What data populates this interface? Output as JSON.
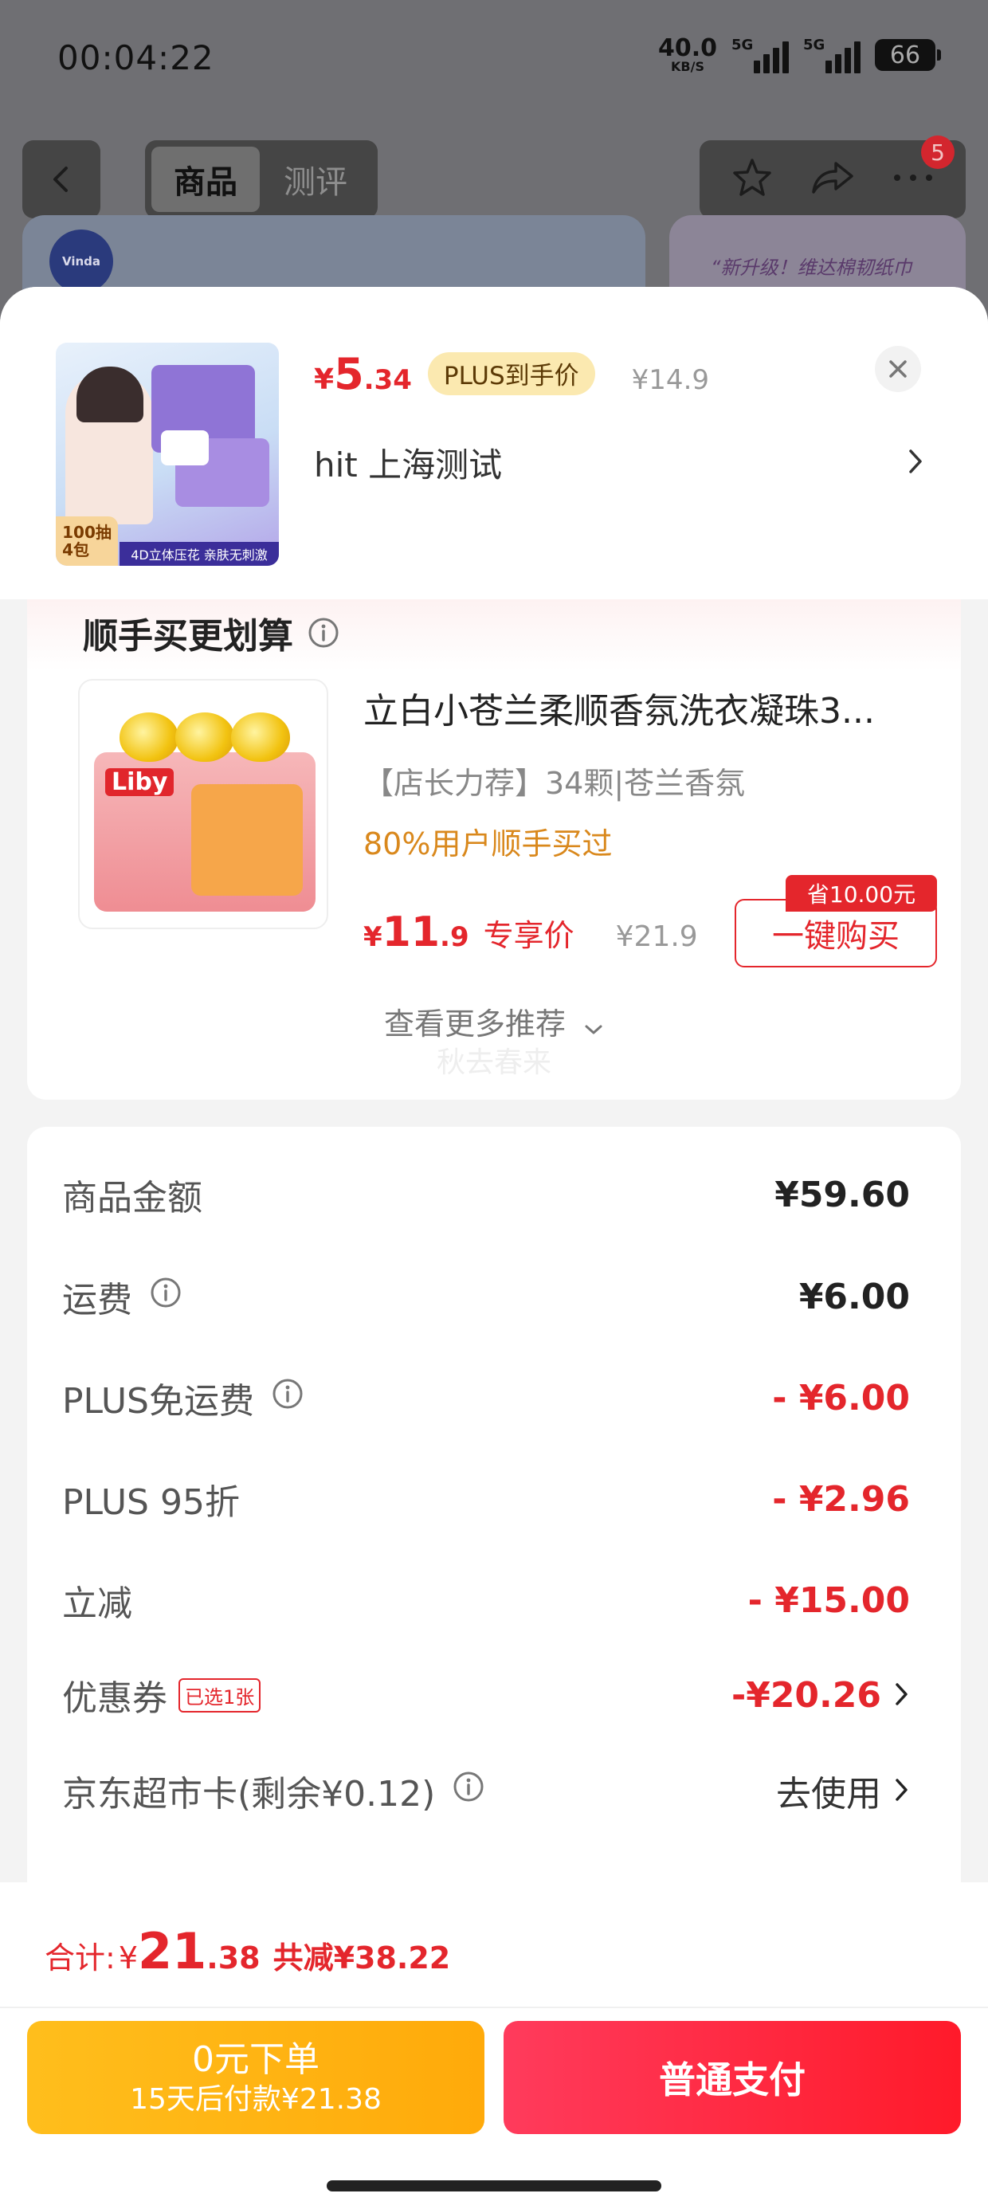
{
  "status_bar": {
    "time": "00:04:22",
    "net_speed_value": "40.0",
    "net_speed_unit": "KB/S",
    "sim1": "5G",
    "sim2": "5G",
    "battery": "66"
  },
  "background_page": {
    "tabs": [
      {
        "label": "商品",
        "active": true
      },
      {
        "label": "测评",
        "active": false
      }
    ],
    "cart_badge": "5",
    "brand_logo": "Vinda",
    "banner_text": "“新升级！维达棉韧纸巾"
  },
  "product": {
    "price_currency": "¥",
    "price_int": "5",
    "price_dec": ".34",
    "plus_tag": "PLUS到手价",
    "original_price": "¥14.9",
    "address": "hit  上海测试",
    "image_count_label": "100抽\n4包",
    "image_strip": "4D立体压花 亲肤无刺激"
  },
  "recommendation": {
    "title": "顺手买更划算",
    "item": {
      "name": "立白小苍兰柔顺香氛洗衣凝珠3...",
      "subtitle": "【店长力荐】34颗|苍兰香氛",
      "stat": "80%用户顺手买过",
      "price_currency": "¥",
      "price_int": "11",
      "price_dec": ".9",
      "exclusive_label": "专享价",
      "original_price": "¥21.9",
      "save_tag": "省10.00元",
      "buy_button": "一键购买",
      "brand": "Liby"
    },
    "more_label": "查看更多推荐",
    "watermark": "秋去春来"
  },
  "fees": [
    {
      "label": "商品金额",
      "value": "¥59.60",
      "style": "normal",
      "info": false
    },
    {
      "label": "运费",
      "value": "¥6.00",
      "style": "normal",
      "info": true
    },
    {
      "label": "PLUS免运费",
      "value": "- ¥6.00",
      "style": "red",
      "info": true
    },
    {
      "label": "PLUS 95折",
      "value": "- ¥2.96",
      "style": "red",
      "info": false
    },
    {
      "label": "立减",
      "value": "- ¥15.00",
      "style": "red",
      "info": false
    },
    {
      "label": "优惠券",
      "tag": "已选1张",
      "value": "-¥20.26",
      "style": "red",
      "info": false,
      "chevron": true
    },
    {
      "label": "京东超市卡(剩余¥0.12)",
      "value": "去使用",
      "style": "plain",
      "info": true,
      "chevron": true
    }
  ],
  "summary": {
    "total_label": "合计:",
    "total_currency": "¥",
    "total_int": "21",
    "total_dec": ".38",
    "discount_text": "共减¥38.22"
  },
  "actions": {
    "pay_later_line1": "0元下单",
    "pay_later_line2": "15天后付款¥21.38",
    "pay_now": "普通支付"
  },
  "colors": {
    "accent_red": "#e4262c",
    "pay_later_yellow": "#ffb312",
    "pay_button_red": "#ff2a3c",
    "stat_orange": "#d9881c"
  }
}
